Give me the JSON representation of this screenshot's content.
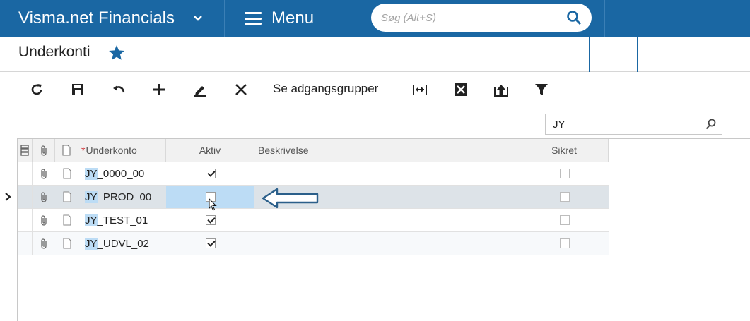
{
  "app": {
    "title": "Visma.net Financials"
  },
  "nav": {
    "menu_label": "Menu"
  },
  "search": {
    "placeholder": "Søg (Alt+S)"
  },
  "page": {
    "title": "Underkonti"
  },
  "toolbar": {
    "access_groups_label": "Se adgangsgrupper"
  },
  "filter": {
    "value": "JY"
  },
  "grid": {
    "columns": {
      "subaccount": "Underkonto",
      "required_mark": "*",
      "active": "Aktiv",
      "description": "Beskrivelse",
      "secured": "Sikret"
    },
    "rows": [
      {
        "prefix": "JY",
        "rest": "_0000_00",
        "active": true,
        "description": "",
        "secured": false
      },
      {
        "prefix": "JY",
        "rest": "_PROD_00",
        "active": false,
        "description": "",
        "secured": false
      },
      {
        "prefix": "JY",
        "rest": "_TEST_01",
        "active": true,
        "description": "",
        "secured": false
      },
      {
        "prefix": "JY",
        "rest": "_UDVL_02",
        "active": true,
        "description": "",
        "secured": false
      }
    ],
    "selected_row": 1
  },
  "colors": {
    "topbar": "#1a67a3",
    "highlight": "#bcdcf5",
    "selected_row": "#dde3e8",
    "star": "#1a67a3",
    "arrow": "#2b5f8a"
  },
  "icons": [
    "chevron-down-icon",
    "hamburger-icon",
    "search-icon",
    "star-icon",
    "refresh-icon",
    "save-icon",
    "undo-icon",
    "add-icon",
    "edit-icon",
    "delete-icon",
    "fit-columns-icon",
    "excel-export-icon",
    "upload-icon",
    "filter-icon",
    "paperclip-icon",
    "note-icon",
    "row-selector-icon",
    "arrow-left-icon",
    "mouse-cursor-icon"
  ]
}
